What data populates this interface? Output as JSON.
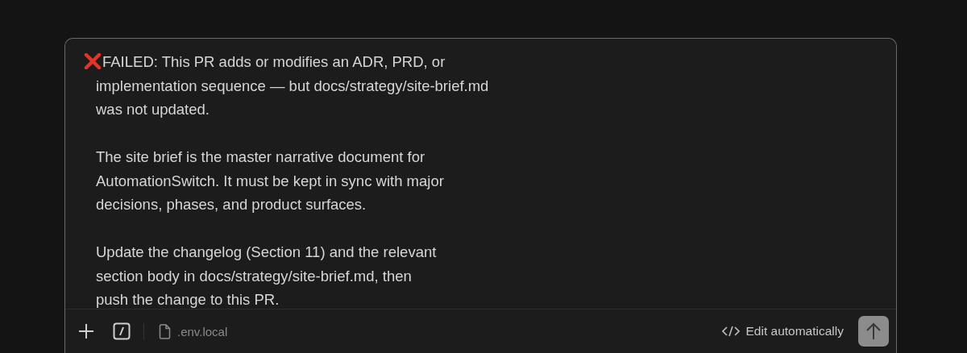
{
  "message": {
    "paragraphs": [
      {
        "kind": "error",
        "text": "FAILED: This PR adds or modifies an ADR, PRD, or\nimplementation sequence — but docs/strategy/site-brief.md\nwas not updated."
      },
      {
        "kind": "plain",
        "text": "The site brief is the master narrative document for\nAutomationSwitch. It must be kept in sync with major\ndecisions, phases, and product surfaces."
      },
      {
        "kind": "plain",
        "text": "Update the changelog (Section 11) and the relevant\nsection body in docs/strategy/site-brief.md, then\npush the change to this PR."
      }
    ]
  },
  "toolbar": {
    "attachment": ".env.local",
    "mode": "Edit automatically"
  }
}
